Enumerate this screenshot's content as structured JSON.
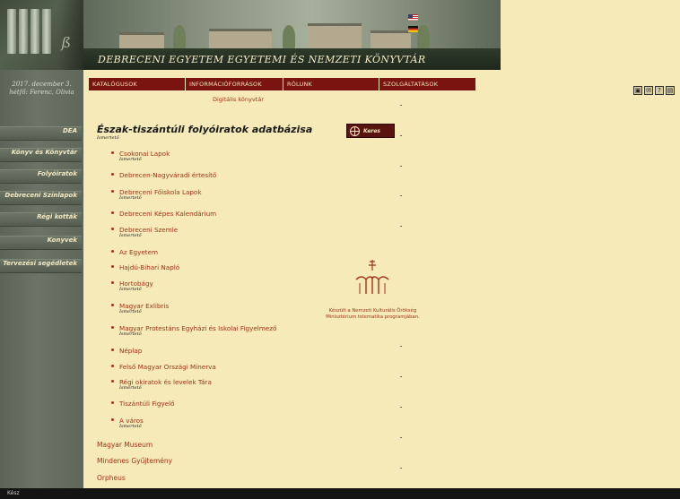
{
  "left_column": {
    "date_line1": "2017. december 3.",
    "date_line2": "hétfő: Ferenc, Olivia",
    "nav": [
      "DEA",
      "Könyv és Könyvtár",
      "Folyóiratok",
      "Debreceni Színlapok",
      "Régi kották",
      "Konyvek",
      "Tervezési segédletek"
    ]
  },
  "banner": {
    "title": "Debreceni Egyetem Egyetemi és Nemzeti Könyvtár",
    "lang_en_icon": "flag-uk-icon",
    "lang_de_icon": "flag-germany-icon"
  },
  "topnav": [
    "KATALÓGUSOK",
    "INFORMÁCIÓFORRÁSOK",
    "RÓLUNK",
    "SZOLGÁLTATÁSOK"
  ],
  "subnav": "Digitális könyvtár",
  "tools": [
    "print-icon",
    "email-icon",
    "help-icon",
    "list-icon"
  ],
  "tool_glyphs": [
    "▣",
    "✉",
    "?",
    "▤"
  ],
  "main": {
    "title": "Észak-tiszántúli folyóiratok adatbázisa",
    "title_sub": "Ismertető",
    "search_label": "Keres",
    "items": [
      {
        "name": "Csokonai Lapok",
        "sub": "Ismertető"
      },
      {
        "name": "Debrecen-Nagyváradi értesítő",
        "sub": ""
      },
      {
        "name": "Debreceni Főiskola Lapok",
        "sub": "Ismertető"
      },
      {
        "name": "Debreceni Képes Kalendárium",
        "sub": ""
      },
      {
        "name": "Debreceni Szemle",
        "sub": "Ismertető"
      },
      {
        "name": "Az Egyetem",
        "sub": ""
      },
      {
        "name": "Hajdú-Bihari Napló",
        "sub": ""
      },
      {
        "name": "Hortobágy",
        "sub": "Ismertető"
      },
      {
        "name": "Magyar Exlibris",
        "sub": "Ismertető"
      },
      {
        "name": "Magyar Protestáns Egyházi és Iskolai Figyelmező",
        "sub": "Ismertető"
      },
      {
        "name": "Néplap",
        "sub": ""
      },
      {
        "name": "Felső Magyar Országi Minerva",
        "sub": ""
      },
      {
        "name": "Régi okiratok és levelek Tára",
        "sub": "Ismertető"
      },
      {
        "name": "Tiszántúli Figyelő",
        "sub": ""
      },
      {
        "name": "A város",
        "sub": "Ismertető"
      }
    ],
    "plain_items": [
      "Magyar Museum",
      "Mindenes Gyűjtemény",
      "Orpheus"
    ],
    "caption_line1": "Készült a Nemzeti Kulturális Örökség",
    "caption_line2": "Minisztérium telematika programjában."
  },
  "statusbar": "Kész"
}
